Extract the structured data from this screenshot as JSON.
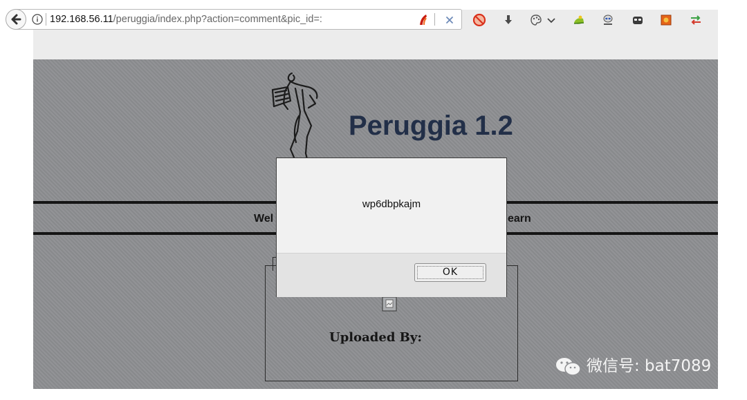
{
  "browser": {
    "url_host": "192.168.56.11",
    "url_path": "/peruggia/index.php?action=comment&pic_id=:",
    "toolbar_icons": [
      "noscript-icon",
      "download-icon",
      "palette-icon",
      "dropdown-icon",
      "frog-icon",
      "alien-icon",
      "mask-icon",
      "firebug-icon",
      "arrows-icon"
    ]
  },
  "page": {
    "title": "Peruggia 1.2",
    "nav_left": "Wel",
    "nav_right": "earn",
    "uploaded_by": "Uploaded By:"
  },
  "dialog": {
    "message": "wp6dbpkajm",
    "ok_label": "OK"
  },
  "watermark": {
    "text": "微信号: bat7089"
  },
  "colors": {
    "page_bg": "#8e8f92",
    "title": "#222f48",
    "dialog_bg": "#f1f1f1"
  }
}
